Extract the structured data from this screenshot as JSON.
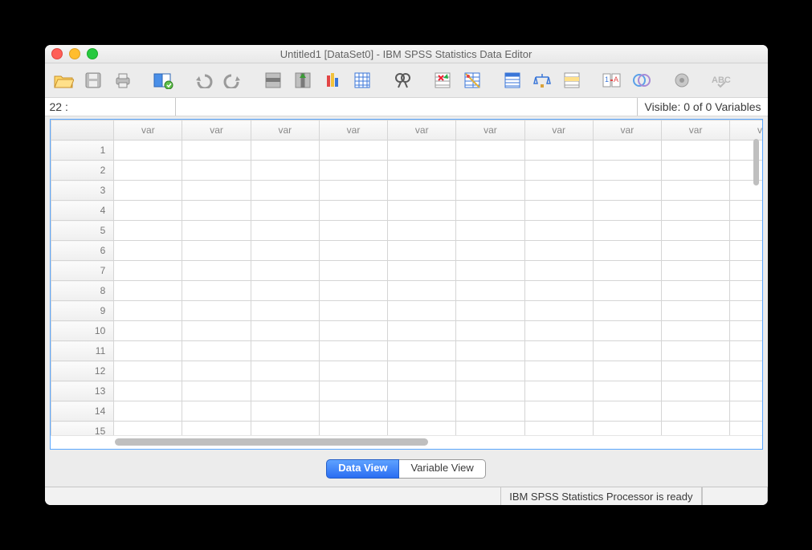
{
  "title": "Untitled1 [DataSet0] - IBM SPSS Statistics Data Editor",
  "toolbar": {
    "icons": [
      "open-file-icon",
      "save-icon",
      "print-icon",
      "",
      "dialog-recall-icon",
      "",
      "undo-icon",
      "redo-icon",
      "",
      "goto-case-icon",
      "goto-variable-icon",
      "variables-icon",
      "run-descriptives-icon",
      "",
      "find-icon",
      "",
      "insert-cases-icon",
      "insert-variable-icon",
      "",
      "split-file-icon",
      "weight-cases-icon",
      "select-cases-icon",
      "",
      "value-labels-icon",
      "use-variable-sets-icon",
      "",
      "show-all-icon",
      "",
      "spellcheck-icon"
    ]
  },
  "locator": {
    "cell_reference": "22 :",
    "cell_value": "",
    "visible_text": "Visible: 0 of 0 Variables"
  },
  "grid": {
    "column_header_label": "var",
    "columns": 10,
    "rows": 16
  },
  "tabs": {
    "data_view": "Data View",
    "variable_view": "Variable View",
    "active": "data_view"
  },
  "status": {
    "message": "IBM SPSS Statistics Processor is ready"
  }
}
